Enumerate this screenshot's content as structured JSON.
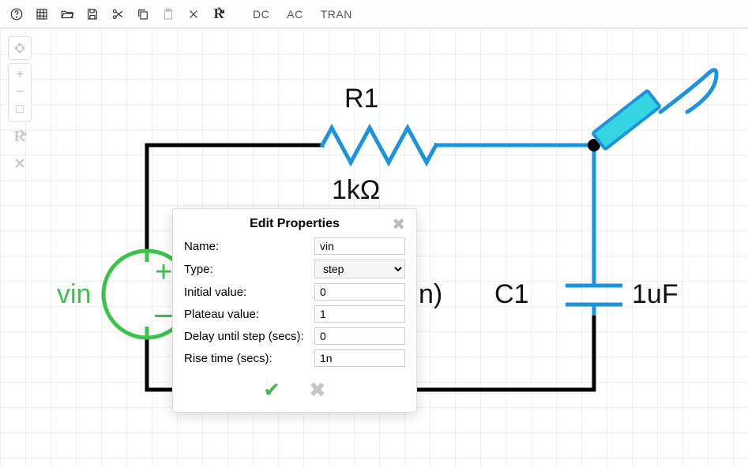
{
  "toolbar": {
    "sim_dc": "DC",
    "sim_ac": "AC",
    "sim_tran": "TRAN"
  },
  "side": {
    "plus": "+",
    "minus": "−",
    "fit": "□"
  },
  "schematic": {
    "r1_label": "R1",
    "r1_value": "1kΩ",
    "vin_label": "vin",
    "vin_plus": "+",
    "vin_minus": "−",
    "obscured_text": "n)",
    "c1_label": "C1",
    "c1_value": "1uF"
  },
  "dialog": {
    "title": "Edit Properties",
    "fields": {
      "name_label": "Name:",
      "name_value": "vin",
      "type_label": "Type:",
      "type_value": "step",
      "initial_label": "Initial value:",
      "initial_value": "0",
      "plateau_label": "Plateau value:",
      "plateau_value": "1",
      "delay_label": "Delay until step (secs):",
      "delay_value": "0",
      "rise_label": "Rise time (secs):",
      "rise_value": "1n"
    }
  }
}
